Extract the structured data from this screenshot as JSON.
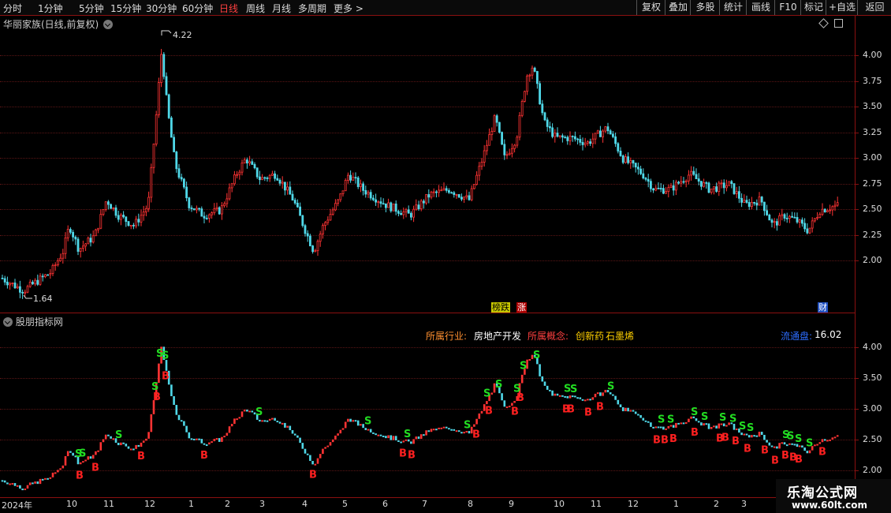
{
  "toolbar": {
    "periods": [
      "分时",
      "1分钟",
      "5分钟",
      "15分钟",
      "30分钟",
      "60分钟",
      "日线",
      "周线",
      "月线",
      "多周期",
      "更多 >"
    ],
    "active_period": "日线",
    "tools": [
      "复权",
      "叠加",
      "多股",
      "统计",
      "画线",
      "F10",
      "标记",
      "+自选",
      "返回"
    ]
  },
  "main_panel": {
    "title": "华丽家族(日线,前复权)",
    "y_ticks": [
      "4.00",
      "3.75",
      "3.50",
      "3.25",
      "3.00",
      "2.75",
      "2.50",
      "2.25",
      "2.00"
    ],
    "high_label": "4.22",
    "low_label": "1.64",
    "badge_decline": "榜跌",
    "badge_rise": "涨",
    "badge_finance": "财"
  },
  "indicator_panel": {
    "title": "股朋指标网",
    "industry_label": "所属行业:",
    "industry_value": "房地产开发",
    "concept_label": "所属概念:",
    "concept_value1": "创新药",
    "concept_value2": "石墨烯",
    "float_label": "流通盘:",
    "float_value": "16.02",
    "y_ticks": [
      "4.00",
      "3.50",
      "3.00",
      "2.50",
      "2.00"
    ]
  },
  "x_axis": {
    "labels": [
      "2024年",
      "10",
      "11",
      "12",
      "1",
      "2",
      "3",
      "4",
      "5",
      "6",
      "7",
      "8",
      "9",
      "10",
      "11",
      "12",
      "1",
      "2",
      "3"
    ]
  },
  "watermark": {
    "title": "乐淘公式网",
    "url": "www.60lt.com"
  },
  "colors": {
    "up": "#ff3333",
    "down": "#4fd8e8",
    "buy_signal": "#ff2020",
    "sell_signal": "#22dd22",
    "axis": "#8a1010"
  }
}
